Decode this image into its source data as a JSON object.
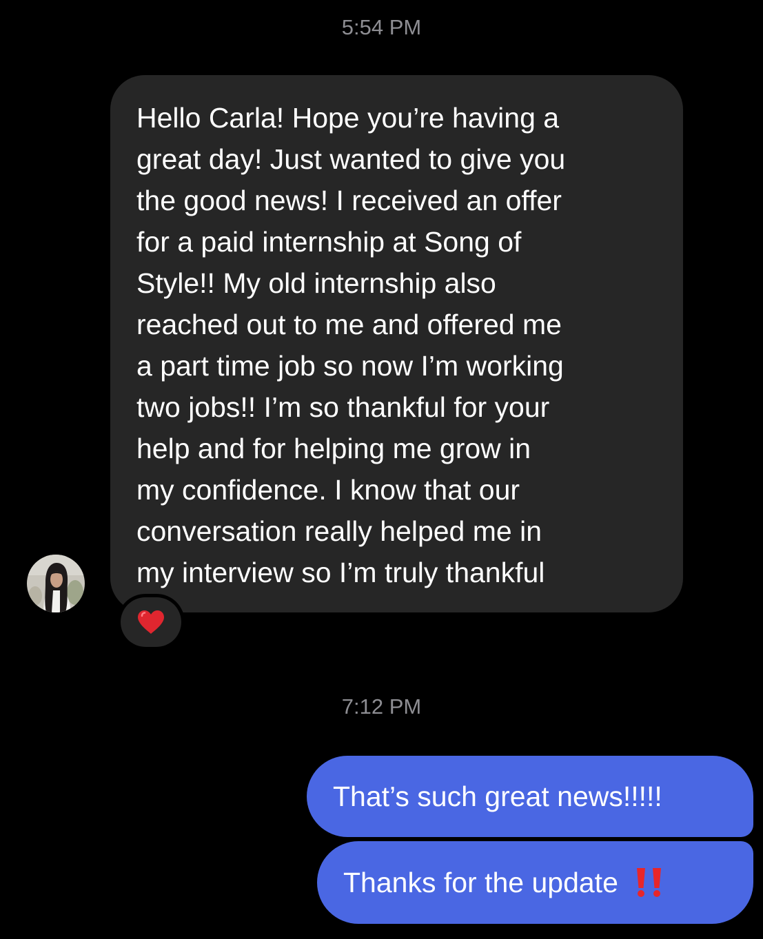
{
  "thread": {
    "timestamp_first": "5:54 PM",
    "incoming_lines": [
      "Hello Carla! Hope you’re having a",
      "great day! Just wanted to give you",
      "the good news! I received an offer",
      "for a paid internship at Song of",
      "Style!! My old internship also",
      "reached out to me and offered me",
      "a part time job so now I’m working",
      "two jobs!! I’m so thankful for your",
      "help and for helping me grow in",
      "my confidence. I know that our",
      "conversation really helped me in",
      "my interview so I’m truly thankful"
    ],
    "reaction_icon": "red-heart-icon",
    "timestamp_second": "7:12 PM",
    "outgoing_1": "That’s such great news!!!!!",
    "outgoing_2": "Thanks for the update",
    "outgoing_2_icon": "double-exclamation-icon"
  },
  "colors": {
    "background": "#000000",
    "incoming_bubble": "#262626",
    "outgoing_bubble": "#4a67e3",
    "timestamp": "#8e8e93",
    "heart": "#e0262f",
    "exclamation": "#e8262a"
  }
}
